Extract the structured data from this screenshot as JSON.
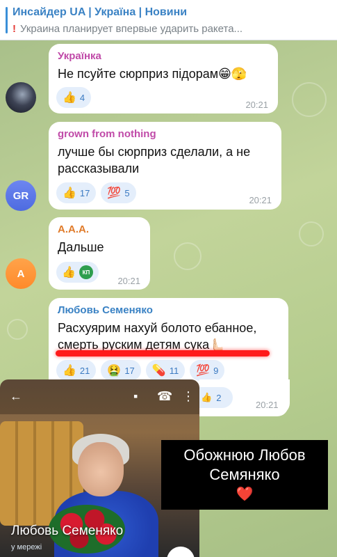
{
  "pinned": {
    "title": "Инсайдер UA | Україна | Новини",
    "preview": "Украина планирует впервые ударить ракета...",
    "excl": "!"
  },
  "messages": [
    {
      "author": "Українка",
      "author_color": "#c04aa8",
      "text": "Не псуйте сюрприз підорам😁🫣",
      "reactions": [
        {
          "emoji": "👍",
          "count": "4"
        }
      ],
      "time": "20:21"
    },
    {
      "author": "grown from nothing",
      "author_color": "#c04aa8",
      "text_lines": [
        "лучше бы сюрприз сделали, а не",
        "рассказывали"
      ],
      "reactions": [
        {
          "emoji": "👍",
          "count": "17"
        },
        {
          "emoji": "💯",
          "count": "5"
        }
      ],
      "avatar_initials": "GR",
      "time": "20:21"
    },
    {
      "author": "A.A.A.",
      "author_color": "#e07b2a",
      "text": "Дальше",
      "reactions": [
        {
          "emoji": "👍",
          "count": ""
        },
        {
          "emoji": "КП",
          "count": ""
        }
      ],
      "avatar_initials": "A",
      "time": "20:21"
    },
    {
      "author": "Любовь Семеняко",
      "author_color": "#3a82c4",
      "text_lines": [
        "Расхуярим нахуй болото ебанное,",
        "смерть руским детям сука🫷🏻"
      ],
      "reactions": [
        {
          "emoji": "👍",
          "count": "21"
        },
        {
          "emoji": "🤮",
          "count": "17"
        },
        {
          "emoji": "💊",
          "count": "11"
        },
        {
          "emoji": "💯",
          "count": "9"
        }
      ],
      "time": "20:21"
    }
  ],
  "partial_reaction": {
    "emoji": "👍",
    "count": "2"
  },
  "profile": {
    "name": "Любовь Семеняко",
    "status": "у мережі",
    "back_icon": "arrow-left-icon",
    "video_icon": "video-camera-icon",
    "call_icon": "phone-icon",
    "menu_icon": "more-vertical-icon"
  },
  "caption": {
    "line1": "Обожнюю  Любов",
    "line2": "Семяняко",
    "heart": "❤️"
  },
  "colors": {
    "accent": "#3a82c4",
    "reaction_bg": "#e4eefb",
    "underline": "#ff1a1a"
  }
}
